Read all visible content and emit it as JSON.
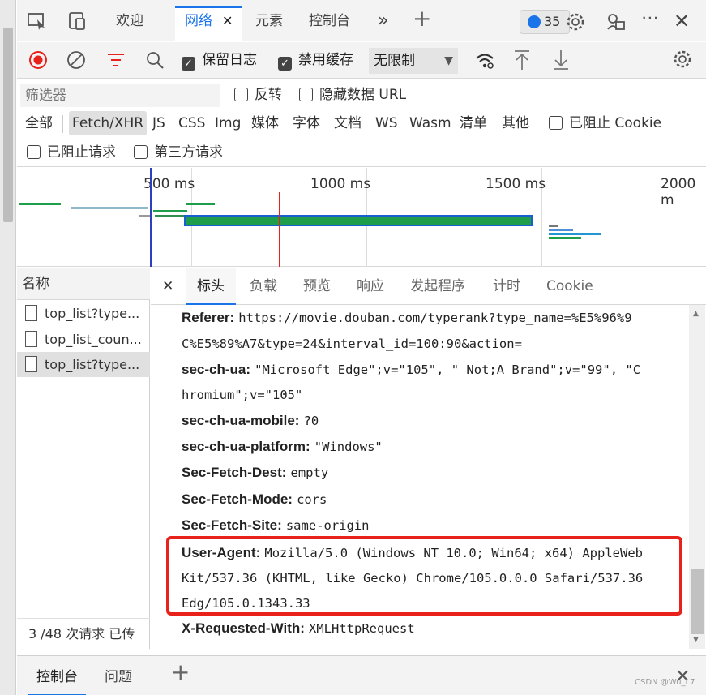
{
  "tabs": {
    "welcome": "欢迎",
    "network": "网络",
    "elements": "元素",
    "console": "控制台",
    "more": "»",
    "add": "+",
    "issue_count": "35"
  },
  "toolbar": {
    "preserve_log": "保留日志",
    "disable_cache": "禁用缓存",
    "throttle": "无限制"
  },
  "filters": {
    "placeholder": "筛选器",
    "invert": "反转",
    "hide_data_urls": "隐藏数据 URL",
    "types": [
      "全部",
      "Fetch/XHR",
      "JS",
      "CSS",
      "Img",
      "媒体",
      "字体",
      "文档",
      "WS",
      "Wasm",
      "清单",
      "其他"
    ],
    "blocked_cookies": "已阻止 Cookie",
    "blocked_requests": "已阻止请求",
    "third_party": "第三方请求"
  },
  "timeline": {
    "ticks": [
      "500 ms",
      "1000 ms",
      "1500 ms",
      "2000 m"
    ]
  },
  "request_list": {
    "header": "名称",
    "items": [
      "top_list?type...",
      "top_list_coun...",
      "top_list?type..."
    ],
    "status": "3 /48 次请求  已传"
  },
  "detail": {
    "close": "✕",
    "tabs": [
      "标头",
      "负载",
      "预览",
      "响应",
      "发起程序",
      "计时",
      "Cookie"
    ],
    "headers": [
      {
        "k": "Referer:",
        "v": "https://movie.douban.com/typerank?type_name=%E5%96%9"
      },
      {
        "k": "",
        "v": "C%E5%89%A7&type=24&interval_id=100:90&action="
      },
      {
        "k": "sec-ch-ua:",
        "v": "\"Microsoft Edge\";v=\"105\", \" Not;A Brand\";v=\"99\", \"C"
      },
      {
        "k": "",
        "v": "hromium\";v=\"105\""
      },
      {
        "k": "sec-ch-ua-mobile:",
        "v": "?0"
      },
      {
        "k": "sec-ch-ua-platform:",
        "v": "\"Windows\""
      },
      {
        "k": "Sec-Fetch-Dest:",
        "v": "empty"
      },
      {
        "k": "Sec-Fetch-Mode:",
        "v": "cors"
      },
      {
        "k": "Sec-Fetch-Site:",
        "v": "same-origin"
      },
      {
        "k": "User-Agent:",
        "v": "Mozilla/5.0 (Windows NT 10.0; Win64; x64) AppleWeb"
      },
      {
        "k": "",
        "v": "Kit/537.36 (KHTML, like Gecko) Chrome/105.0.0.0 Safari/537.36"
      },
      {
        "k": "",
        "v": "Edg/105.0.1343.33"
      },
      {
        "k": "X-Requested-With:",
        "v": "XMLHttpRequest"
      }
    ]
  },
  "drawer": {
    "console": "控制台",
    "issues": "问题",
    "add": "+",
    "close": "✕"
  },
  "watermark": "CSDN @Wu_L7",
  "colors": {
    "accent": "#1a73e8",
    "record_red": "#e8221b",
    "highlight_box": "#e8221b",
    "timeline_green": "#1e9e4a"
  }
}
